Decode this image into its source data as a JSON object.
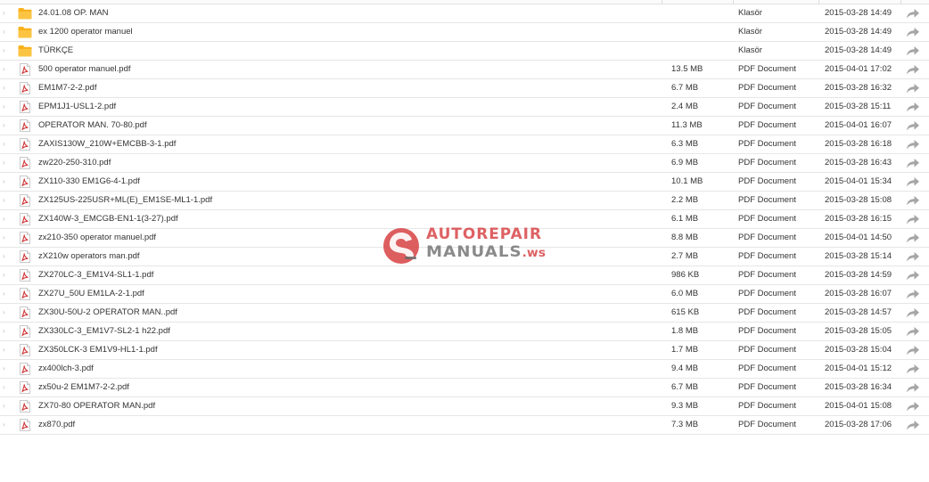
{
  "columns": {
    "size_header": "",
    "type_header": "",
    "date_header": ""
  },
  "files": [
    {
      "name": "24.01.08 OP. MAN",
      "size": "",
      "type": "Klasör",
      "modified": "2015-03-28 14:49",
      "kind": "folder"
    },
    {
      "name": "ex 1200 operator manuel",
      "size": "",
      "type": "Klasör",
      "modified": "2015-03-28 14:49",
      "kind": "folder"
    },
    {
      "name": "TÜRKÇE",
      "size": "",
      "type": "Klasör",
      "modified": "2015-03-28 14:49",
      "kind": "folder"
    },
    {
      "name": "500 operator manuel.pdf",
      "size": "13.5 MB",
      "type": "PDF Document",
      "modified": "2015-04-01 17:02",
      "kind": "pdf"
    },
    {
      "name": "EM1M7-2-2.pdf",
      "size": "6.7 MB",
      "type": "PDF Document",
      "modified": "2015-03-28 16:32",
      "kind": "pdf"
    },
    {
      "name": "EPM1J1-USL1-2.pdf",
      "size": "2.4 MB",
      "type": "PDF Document",
      "modified": "2015-03-28 15:11",
      "kind": "pdf"
    },
    {
      "name": "OPERATOR MAN. 70-80.pdf",
      "size": "11.3 MB",
      "type": "PDF Document",
      "modified": "2015-04-01 16:07",
      "kind": "pdf"
    },
    {
      "name": "ZAXIS130W_210W+EMCBB-3-1.pdf",
      "size": "6.3 MB",
      "type": "PDF Document",
      "modified": "2015-03-28 16:18",
      "kind": "pdf"
    },
    {
      "name": "zw220-250-310.pdf",
      "size": "6.9 MB",
      "type": "PDF Document",
      "modified": "2015-03-28 16:43",
      "kind": "pdf"
    },
    {
      "name": "ZX110-330 EM1G6-4-1.pdf",
      "size": "10.1 MB",
      "type": "PDF Document",
      "modified": "2015-04-01 15:34",
      "kind": "pdf"
    },
    {
      "name": "ZX125US-225USR+ML(E)_EM1SE-ML1-1.pdf",
      "size": "2.2 MB",
      "type": "PDF Document",
      "modified": "2015-03-28 15:08",
      "kind": "pdf"
    },
    {
      "name": "ZX140W-3_EMCGB-EN1-1(3-27).pdf",
      "size": "6.1 MB",
      "type": "PDF Document",
      "modified": "2015-03-28 16:15",
      "kind": "pdf"
    },
    {
      "name": "zx210-350 operator manuel.pdf",
      "size": "8.8 MB",
      "type": "PDF Document",
      "modified": "2015-04-01 14:50",
      "kind": "pdf"
    },
    {
      "name": "zX210w operators man.pdf",
      "size": "2.7 MB",
      "type": "PDF Document",
      "modified": "2015-03-28 15:14",
      "kind": "pdf"
    },
    {
      "name": "ZX270LC-3_EM1V4-SL1-1.pdf",
      "size": "986 KB",
      "type": "PDF Document",
      "modified": "2015-03-28 14:59",
      "kind": "pdf"
    },
    {
      "name": "ZX27U_50U EM1LA-2-1.pdf",
      "size": "6.0 MB",
      "type": "PDF Document",
      "modified": "2015-03-28 16:07",
      "kind": "pdf"
    },
    {
      "name": "ZX30U-50U-2 OPERATOR MAN..pdf",
      "size": "615 KB",
      "type": "PDF Document",
      "modified": "2015-03-28 14:57",
      "kind": "pdf"
    },
    {
      "name": "ZX330LC-3_EM1V7-SL2-1 h22.pdf",
      "size": "1.8 MB",
      "type": "PDF Document",
      "modified": "2015-03-28 15:05",
      "kind": "pdf"
    },
    {
      "name": "ZX350LCK-3 EM1V9-HL1-1.pdf",
      "size": "1.7 MB",
      "type": "PDF Document",
      "modified": "2015-03-28 15:04",
      "kind": "pdf"
    },
    {
      "name": "zx400lch-3.pdf",
      "size": "9.4 MB",
      "type": "PDF Document",
      "modified": "2015-04-01 15:12",
      "kind": "pdf"
    },
    {
      "name": "zx50u-2 EM1M7-2-2.pdf",
      "size": "6.7 MB",
      "type": "PDF Document",
      "modified": "2015-03-28 16:34",
      "kind": "pdf"
    },
    {
      "name": "ZX70-80 OPERATOR MAN.pdf",
      "size": "9.3 MB",
      "type": "PDF Document",
      "modified": "2015-04-01 15:08",
      "kind": "pdf"
    },
    {
      "name": "zx870.pdf",
      "size": "7.3 MB",
      "type": "PDF Document",
      "modified": "2015-03-28 17:06",
      "kind": "pdf"
    }
  ],
  "icons": {
    "folder": "folder-icon",
    "pdf": "pdf-file-icon",
    "share": "share-arrow-icon",
    "row_marker": "row-marker-icon"
  },
  "colors": {
    "folder": "#f9b21d",
    "pdf_red": "#d0393a",
    "share_gray": "#a6a6a6",
    "text": "#333333",
    "row_border": "#e6e6e6"
  },
  "watermark": {
    "line1": "AUTOREPAIR",
    "line2": "MANUALS",
    "line2_suffix": ".ws"
  }
}
